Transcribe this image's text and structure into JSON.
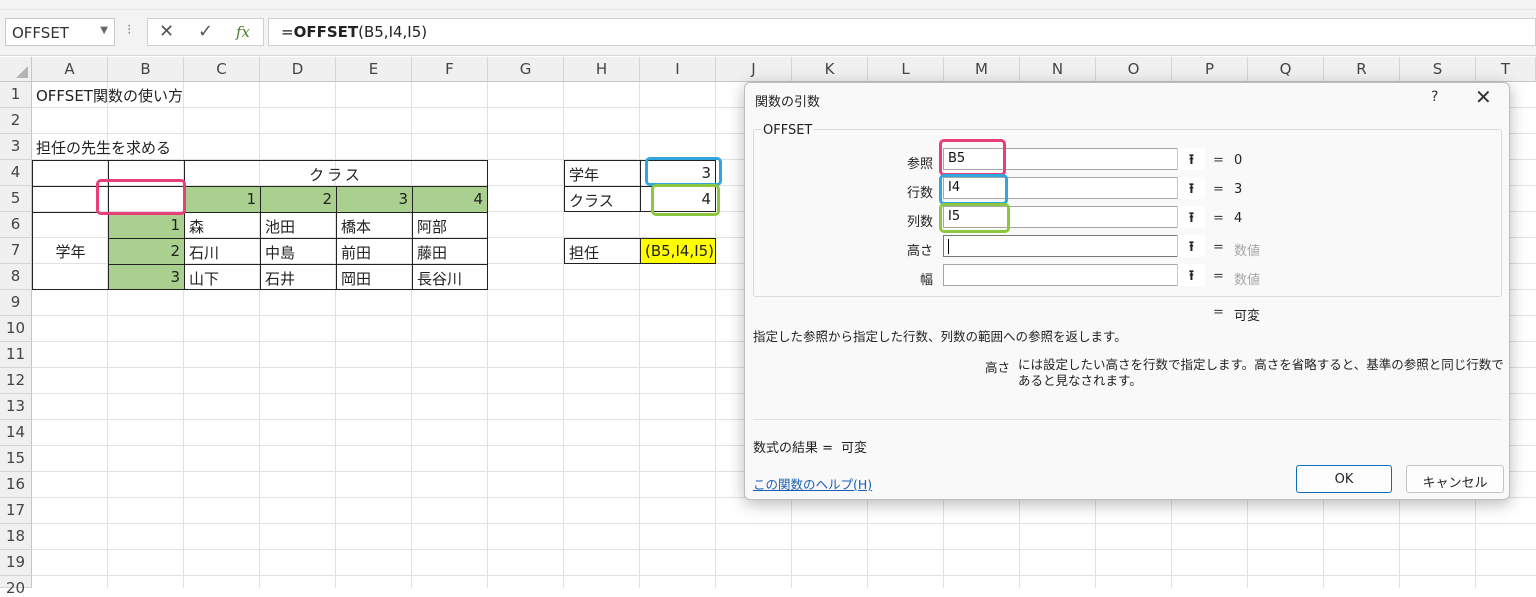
{
  "formula_bar": {
    "name_box": "OFFSET",
    "cancel_icon": "✕",
    "enter_icon": "✓",
    "fx_label": "fx",
    "formula_prefix": "=",
    "formula_func": "OFFSET",
    "formula_args": "(B5,I4,I5)"
  },
  "columns": [
    "A",
    "B",
    "C",
    "D",
    "E",
    "F",
    "G",
    "H",
    "I",
    "J",
    "K",
    "L",
    "M",
    "N",
    "O",
    "P",
    "Q",
    "R",
    "S",
    "T"
  ],
  "rows": [
    "1",
    "2",
    "3",
    "4",
    "5",
    "6",
    "7",
    "8",
    "9",
    "10",
    "11",
    "12",
    "13",
    "14",
    "15",
    "16",
    "17",
    "18",
    "19",
    "20"
  ],
  "cells": {
    "a1": "OFFSET関数の使い方",
    "a3": "担任の先生を求める",
    "class_header": "クラス",
    "class_numbers": [
      "1",
      "2",
      "3",
      "4"
    ],
    "grade_label": "学年",
    "grade_numbers": [
      "1",
      "2",
      "3"
    ],
    "teachers": [
      [
        "森",
        "池田",
        "橋本",
        "阿部"
      ],
      [
        "石川",
        "中島",
        "前田",
        "藤田"
      ],
      [
        "山下",
        "石井",
        "岡田",
        "長谷川"
      ]
    ],
    "h4": "学年",
    "i4": "3",
    "h5": "クラス",
    "i5": "4",
    "h7": "担任",
    "i7": "(B5,I4,I5)"
  },
  "dialog": {
    "title": "関数の引数",
    "help": "?",
    "close": "✕",
    "function_name": "OFFSET",
    "args": [
      {
        "label": "参照",
        "value": "B5",
        "result": "0",
        "muted": false
      },
      {
        "label": "行数",
        "value": "I4",
        "result": "3",
        "muted": false
      },
      {
        "label": "列数",
        "value": "I5",
        "result": "4",
        "muted": false
      },
      {
        "label": "高さ",
        "value": "",
        "result": "数値",
        "muted": true
      },
      {
        "label": "幅",
        "value": "",
        "result": "数値",
        "muted": true
      }
    ],
    "ref_icon": "⭱",
    "eq": "=",
    "total_result": "可変",
    "description": "指定した参照から指定した行数、列数の範囲への参照を返します。",
    "arg_desc_name": "高さ",
    "arg_desc_text": "には設定したい高さを行数で指定します。高さを省略すると、基準の参照と同じ行数であると見なされます。",
    "result_label": "数式の結果 =",
    "result_value": "可変",
    "help_link": "この関数のヘルプ(H)",
    "ok": "OK",
    "cancel": "キャンセル"
  },
  "colors": {
    "green_fill": "#a9d08e",
    "yellow_fill": "#ffff00",
    "highlight_pink": "#e83e7a",
    "highlight_blue": "#2fa6dd",
    "highlight_green": "#8dc63f"
  }
}
